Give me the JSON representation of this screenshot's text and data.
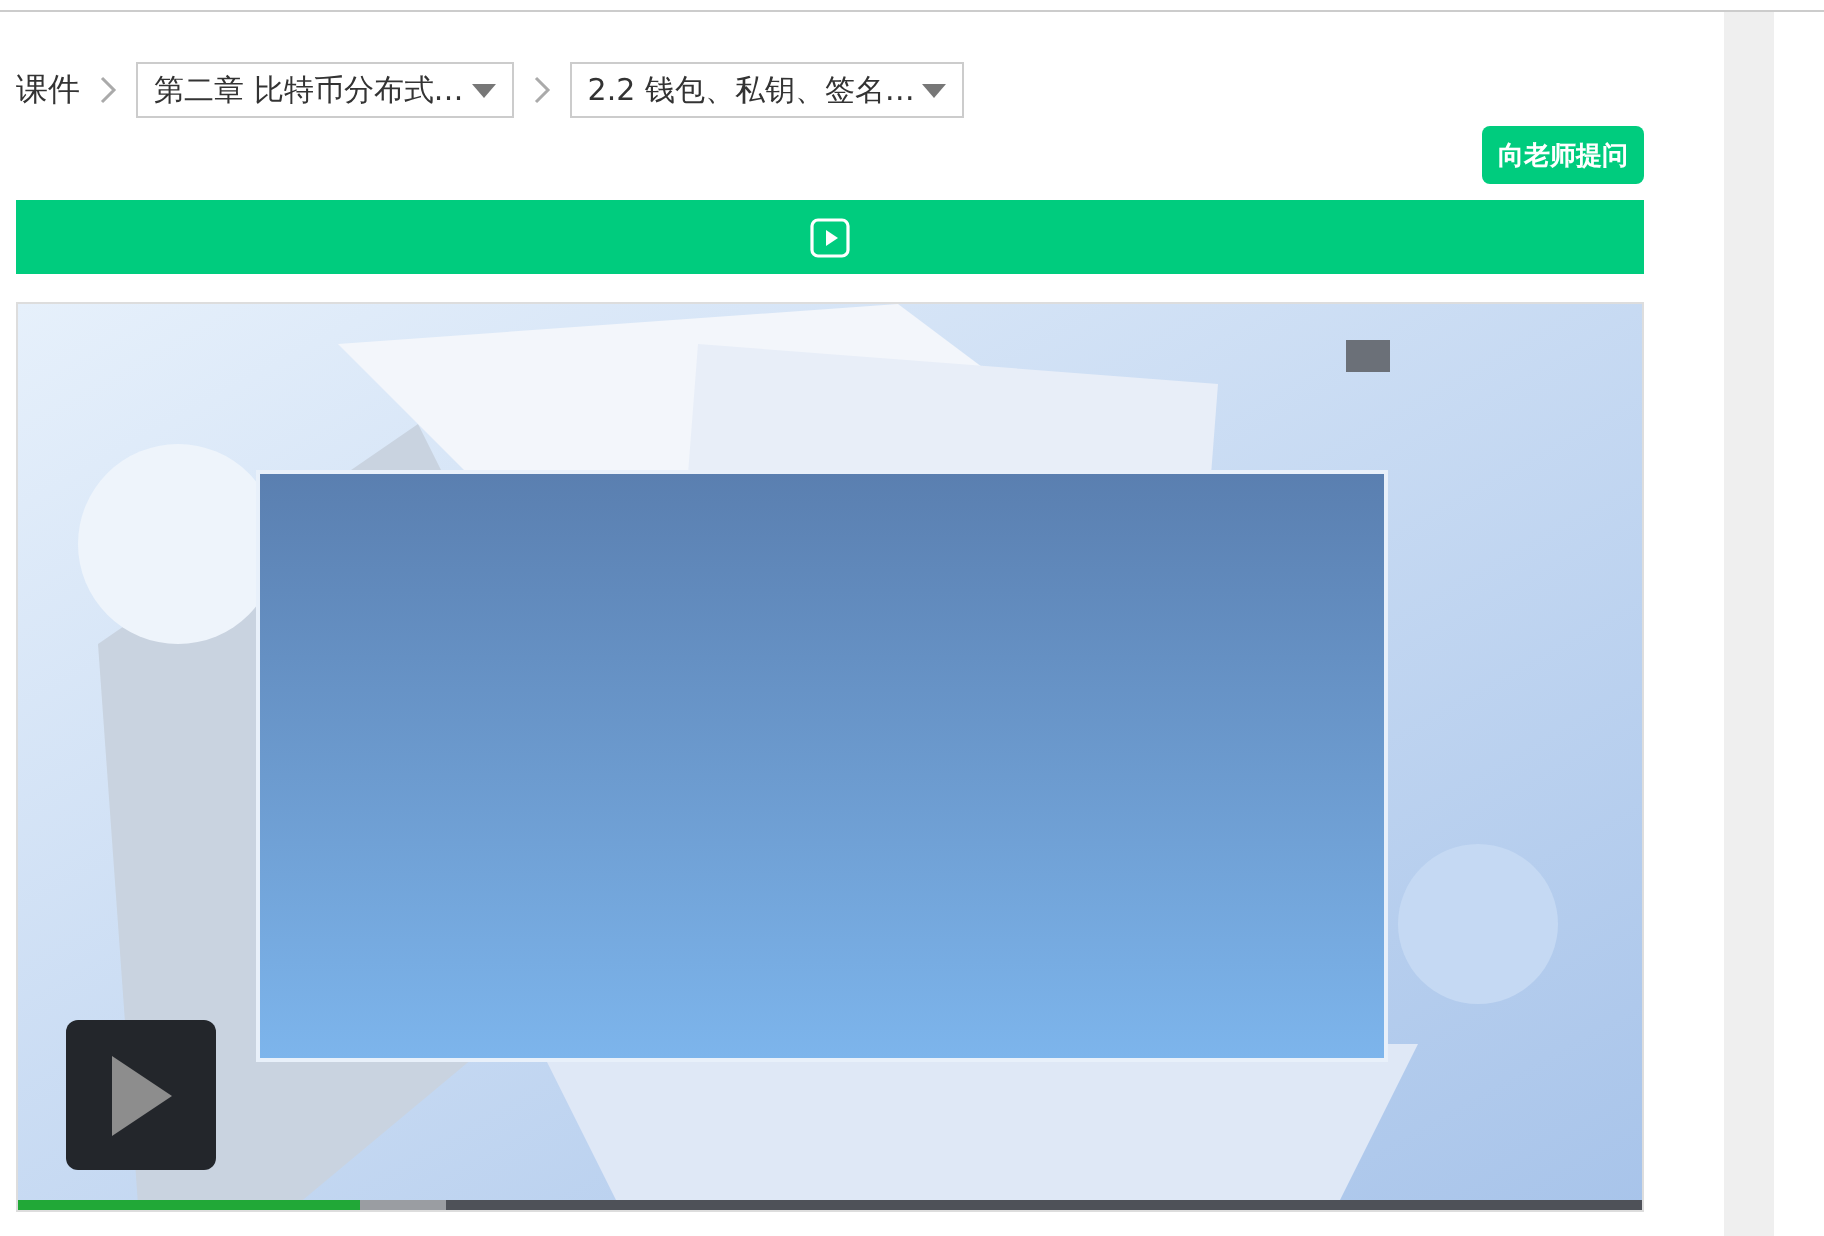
{
  "breadcrumb": {
    "root": "课件",
    "selects": [
      {
        "value": "第二章 比特币分布式…"
      },
      {
        "value": "2.2 钱包、私钥、签名…"
      }
    ]
  },
  "ask_button": "向老师提问",
  "media_bar": {
    "kind": "video"
  },
  "player": {
    "paused": true,
    "progress": {
      "played": {
        "level": 0.21
      },
      "buffered": {
        "level": 0.263
      }
    }
  }
}
